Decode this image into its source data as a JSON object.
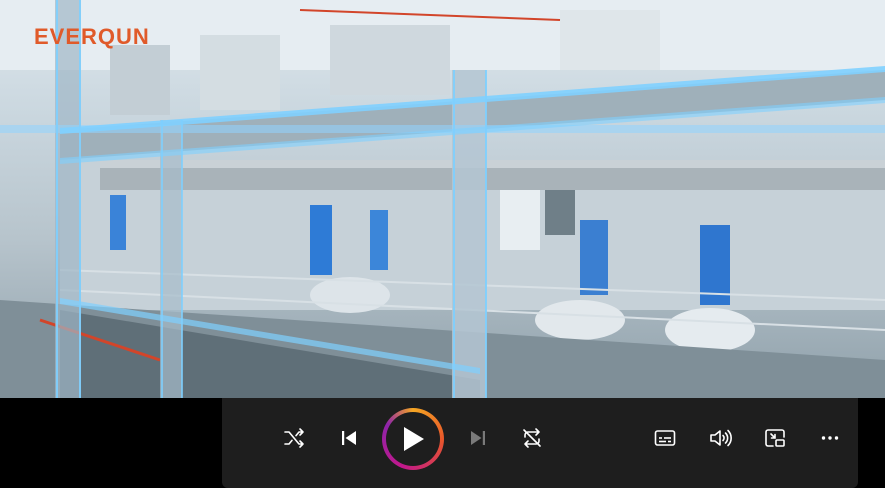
{
  "video": {
    "brand_logo": "EVERQUN"
  },
  "player": {
    "controls": [
      {
        "name": "shuffle",
        "icon": "shuffle-icon"
      },
      {
        "name": "previous",
        "icon": "skip-previous-icon"
      },
      {
        "name": "play",
        "icon": "play-icon"
      },
      {
        "name": "next",
        "icon": "skip-next-icon",
        "enabled": false
      },
      {
        "name": "repeat",
        "icon": "repeat-icon"
      },
      {
        "name": "captions",
        "icon": "captions-icon"
      },
      {
        "name": "volume",
        "icon": "volume-icon"
      },
      {
        "name": "mini-player",
        "icon": "mini-player-icon"
      },
      {
        "name": "more",
        "icon": "more-icon"
      }
    ],
    "colors": {
      "bar": "#1e1e1e",
      "icon": "#ffffff",
      "icon_disabled": "#7a7a7a",
      "play_ring_start": "#f5a623",
      "play_ring_end": "#8e24aa"
    }
  }
}
